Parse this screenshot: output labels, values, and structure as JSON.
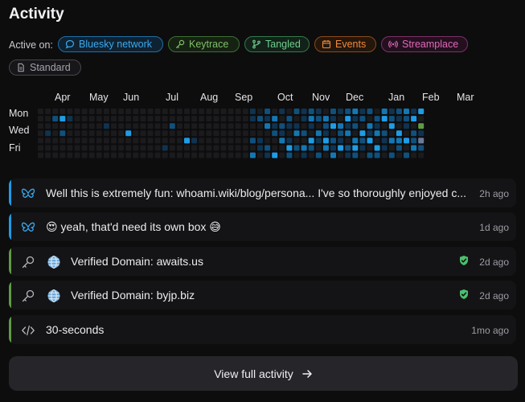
{
  "header": {
    "title": "Activity",
    "active_on_label": "Active on:"
  },
  "platforms": [
    {
      "label": "Bluesky network",
      "icon": "chat-bubble-icon",
      "color": "#3aa9ee"
    },
    {
      "label": "Keytrace",
      "icon": "key-icon",
      "color": "#7fbf6a"
    },
    {
      "label": "Tangled",
      "icon": "git-branch-icon",
      "color": "#6fcf8f"
    },
    {
      "label": "Events",
      "icon": "calendar-icon",
      "color": "#f08a3e"
    },
    {
      "label": "Streamplace",
      "icon": "broadcast-icon",
      "color": "#e06aba"
    },
    {
      "label": "Standard",
      "icon": "document-icon",
      "color": "#a3a3ab"
    }
  ],
  "heatmap": {
    "months": [
      "Apr",
      "May",
      "Jun",
      "Jul",
      "Aug",
      "Sep",
      "Oct",
      "Nov",
      "Dec",
      "Jan",
      "Feb",
      "Mar"
    ],
    "weekdays": [
      "Mon",
      "Wed",
      "Fri"
    ],
    "palette": [
      "#1b1b1e",
      "#0f3350",
      "#10507c",
      "#1477b3",
      "#1e9ce6"
    ],
    "special_colors": {
      "g": "#5f9b45",
      "s": "#6c7a99"
    },
    "weeks_data": [
      "0000000",
      "0000000",
      "0000000",
      "0000000",
      "0140000",
      "0000000",
      "0000000",
      "0000000",
      "0000000",
      "0000000",
      "0000000",
      "0000000",
      "0004000",
      "0000000",
      "0000000",
      "0000000",
      "0000000",
      "0000040",
      "0000000",
      "0000000",
      "0000400",
      "0000100",
      "0000000",
      "0000000",
      "0000000",
      "0000000",
      "0000000",
      "0000000",
      "0000000",
      "0000000",
      "0000000",
      "0000000",
      "0000040",
      "0000000",
      "0000000",
      "0000000",
      "0000000",
      "0000000",
      "0000000",
      "0000000",
      "0000000",
      "0000000",
      "0000000",
      "0000000",
      "0000000",
      "0000000",
      "0000000",
      "0000000",
      "0000000",
      "0000000",
      "0000000",
      "0000000",
      "0000000",
      "0000000",
      "0000000",
      "0000000",
      "0000000",
      "0000000",
      "0000000",
      "0000000",
      "0000000",
      "0000000",
      "0000000",
      "0000000",
      "0000000",
      "0000000",
      "0000000",
      "0000000",
      "0000000",
      "0000000",
      "0000000",
      "0000000",
      "0000000",
      "0000000",
      "0000000",
      "0000000",
      "0000000",
      "0000000",
      "0000000",
      "0000000",
      "0000000",
      "0000000",
      "0000000",
      "0000000",
      "0000000",
      "0000000",
      "0000000",
      "0000000",
      "0000000",
      "0000000",
      "0000000",
      "0000000",
      "0000000",
      "0000000",
      "0000000",
      "0000000",
      "0000000",
      "0000000",
      "0000000",
      "0000000",
      "0000000",
      "0000000",
      "0000000",
      "0000000"
    ],
    "weeks": [
      "0000000",
      "0000000",
      "0002000",
      "0401000",
      "0100000",
      "0000000",
      "0000000",
      "0000000",
      "0010000",
      "0000000",
      "0000000",
      "0000000",
      "0000000",
      "0004000",
      "0000000",
      "0000000",
      "0000000",
      "0000000",
      "0000040",
      "0000000",
      "0000000",
      "0000000",
      "0003000",
      "0000000",
      "0000000",
      "0000000",
      "0000000",
      "0000000",
      "0000000",
      "0000000",
      "0000000",
      "0100000",
      "0000000",
      "0000000",
      "0000000",
      "0000000",
      "0000000",
      "0000000",
      "0000000",
      "0000000",
      "0000000",
      "0000000",
      "0000000",
      "0000000",
      "0000000",
      "0000000",
      "0000000",
      "0000000",
      "0000000",
      "0000000",
      "0000000",
      "0000000",
      "0000000"
    ]
  },
  "feed": [
    {
      "platform_icon": "butterfly-icon",
      "accent": "#1e9ce6",
      "text": "Well this is extremely fun: whoami.wiki/blog/persona... I've so thoroughly enjoyed c...",
      "time": "2h ago",
      "has_globe": false,
      "verified": false
    },
    {
      "platform_icon": "butterfly-icon",
      "accent": "#1e9ce6",
      "text": "😍 yeah, that'd need its own box 😅",
      "time": "1d ago",
      "has_globe": false,
      "verified": false
    },
    {
      "platform_icon": "key-icon",
      "accent": "#5f9b45",
      "text": "Verified Domain: awaits.us",
      "time": "2d ago",
      "has_globe": true,
      "verified": true
    },
    {
      "platform_icon": "key-icon",
      "accent": "#5f9b45",
      "text": "Verified Domain: byjp.biz",
      "time": "2d ago",
      "has_globe": true,
      "verified": true
    },
    {
      "platform_icon": "code-icon",
      "accent": "#5f9b45",
      "text": "30-seconds",
      "time": "1mo ago",
      "has_globe": false,
      "verified": false
    }
  ],
  "footer": {
    "view_all_label": "View full activity"
  }
}
